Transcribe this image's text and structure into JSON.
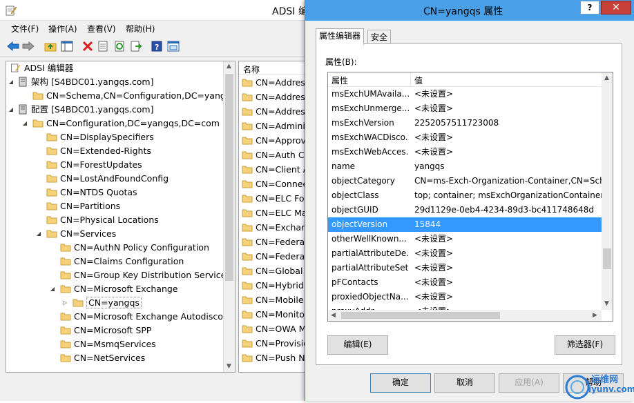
{
  "main_window": {
    "title": "ADSI 编",
    "menu": [
      "文件(F)",
      "操作(A)",
      "查看(V)",
      "帮助(H)"
    ],
    "toolbar_icons": [
      "back-icon",
      "forward-icon",
      "up-folder-icon",
      "show-hide-tree-icon",
      "delete-icon",
      "properties-icon",
      "refresh-icon",
      "export-list-icon",
      "help-icon",
      "console-tree-icon"
    ],
    "tree": {
      "root": "ADSI 编辑器",
      "items": [
        {
          "label": "架构 [S4BDC01.yangqs.com]"
        },
        {
          "label": "CN=Schema,CN=Configuration,DC=yangqs"
        },
        {
          "label": "配置 [S4BDC01.yangqs.com]"
        },
        {
          "label": "CN=Configuration,DC=yangqs,DC=com"
        },
        {
          "label": "CN=DisplaySpecifiers"
        },
        {
          "label": "CN=Extended-Rights"
        },
        {
          "label": "CN=ForestUpdates"
        },
        {
          "label": "CN=LostAndFoundConfig"
        },
        {
          "label": "CN=NTDS Quotas"
        },
        {
          "label": "CN=Partitions"
        },
        {
          "label": "CN=Physical Locations"
        },
        {
          "label": "CN=Services"
        },
        {
          "label": "CN=AuthN Policy Configuration"
        },
        {
          "label": "CN=Claims Configuration"
        },
        {
          "label": "CN=Group Key Distribution Service"
        },
        {
          "label": "CN=Microsoft Exchange"
        },
        {
          "label": "CN=yangqs"
        },
        {
          "label": "CN=Microsoft Exchange Autodiscov"
        },
        {
          "label": "CN=Microsoft SPP"
        },
        {
          "label": "CN=MsmqServices"
        },
        {
          "label": "CN=NetServices"
        }
      ]
    },
    "list": {
      "header": "名称",
      "items": [
        "CN=Address",
        "CN=Address",
        "CN=Address",
        "CN=Adminis",
        "CN=Approva",
        "CN=Auth Co",
        "CN=Client A",
        "CN=Connect",
        "CN=ELC Fold",
        "CN=ELC Ma",
        "CN=Exchang",
        "CN=Federat",
        "CN=Federat",
        "CN=Global S",
        "CN=Hybrid C",
        "CN=Mobile",
        "CN=Monitor",
        "CN=OWA M",
        "CN=Provisio",
        "CN=Push No"
      ]
    }
  },
  "dialog": {
    "title": "CN=yangqs 属性",
    "help_label": "?",
    "close_label": "✕",
    "tabs": [
      "属性编辑器",
      "安全"
    ],
    "attributes_label": "属性(B):",
    "columns": [
      "属性",
      "值"
    ],
    "rows": [
      {
        "attr": "msExchUMAvaila...",
        "value": "<未设置>"
      },
      {
        "attr": "msExchUnmerge...",
        "value": "<未设置>"
      },
      {
        "attr": "msExchVersion",
        "value": "2252057511723008"
      },
      {
        "attr": "msExchWACDisco...",
        "value": "<未设置>"
      },
      {
        "attr": "msExchWebAcces...",
        "value": "<未设置>"
      },
      {
        "attr": "name",
        "value": "yangqs"
      },
      {
        "attr": "objectCategory",
        "value": "CN=ms-Exch-Organization-Container,CN=Sche"
      },
      {
        "attr": "objectClass",
        "value": "top; container; msExchOrganizationContainer"
      },
      {
        "attr": "objectGUID",
        "value": "29d1129e-0eb4-4234-89d3-bc411748648d"
      },
      {
        "attr": "objectVersion",
        "value": "15844",
        "selected": true
      },
      {
        "attr": "otherWellKnown...",
        "value": "<未设置>"
      },
      {
        "attr": "partialAttributeDe...",
        "value": "<未设置>"
      },
      {
        "attr": "partialAttributeSet",
        "value": "<未设置>"
      },
      {
        "attr": "pFContacts",
        "value": "<未设置>"
      },
      {
        "attr": "proxiedObjectNa...",
        "value": "<未设置>"
      },
      {
        "attr": "proxyAddr...",
        "value": "<未设置>"
      }
    ],
    "edit_button": "编辑(E)",
    "filter_button": "筛选器(F)",
    "ok_button": "确定",
    "cancel_button": "取消",
    "apply_button": "应用(A)",
    "help_button": "帮助"
  },
  "watermark": {
    "line1": "运维网",
    "line2": "iyunv.com"
  },
  "colors": {
    "selection": "#3399ff",
    "dialog_title": "#4aa0e6",
    "close": "#c7413a"
  }
}
